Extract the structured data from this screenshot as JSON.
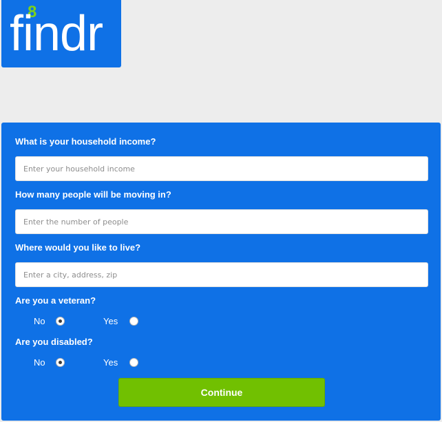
{
  "logo": {
    "text": "findr",
    "superscript": "8"
  },
  "form": {
    "income": {
      "question": "What is your household income?",
      "placeholder": "Enter your household income",
      "value": ""
    },
    "people": {
      "question": "How many people will be moving in?",
      "placeholder": "Enter the number of people",
      "value": ""
    },
    "location": {
      "question": "Where would you like to live?",
      "placeholder": "Enter a city, address, zip",
      "value": ""
    },
    "veteran": {
      "question": "Are you a veteran?",
      "no_label": "No",
      "yes_label": "Yes",
      "selected": "No"
    },
    "disabled": {
      "question": "Are you disabled?",
      "no_label": "No",
      "yes_label": "Yes",
      "selected": "No"
    },
    "continue_label": "Continue"
  },
  "colors": {
    "brand_blue": "#0f71e6",
    "logo_accent": "#7cd11c",
    "continue_green": "#71c001",
    "page_bg": "#ededed"
  }
}
